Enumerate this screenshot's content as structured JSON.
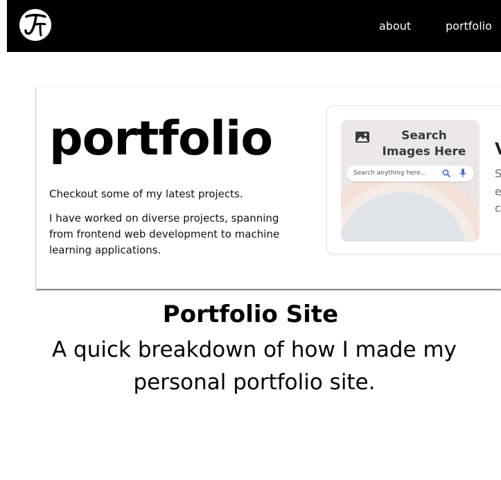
{
  "navbar": {
    "logo_text": "JT",
    "links": [
      {
        "label": "about"
      },
      {
        "label": "portfolio"
      }
    ]
  },
  "preview": {
    "title": "portfolio",
    "lead": "Checkout some of my latest projects.",
    "body": "I have worked on diverse projects, spanning from frontend web development to machine learning applications.",
    "project": {
      "thumb_title": "Search Images Here",
      "search_placeholder": "Search anything here...",
      "peek_heading": "V",
      "peek_lines": [
        "S",
        "e",
        "c"
      ]
    }
  },
  "post": {
    "title": "Portfolio Site",
    "subtitle": "A quick breakdown of how I made my personal portfolio site."
  },
  "colors": {
    "navbar_bg": "#000000",
    "nav_text": "#ffffff",
    "page_bg": "#ffffff",
    "text": "#000000"
  },
  "icons": [
    "logo-icon",
    "image-icon",
    "search-icon",
    "microphone-icon"
  ]
}
